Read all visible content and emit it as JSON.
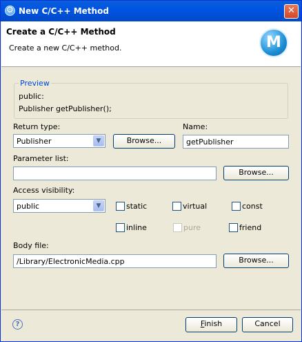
{
  "window": {
    "title": "New C/C++ Method"
  },
  "header": {
    "title": "Create a C/C++ Method",
    "description": "Create a new C/C++ method.",
    "logo_letter": "M"
  },
  "preview": {
    "legend": "Preview",
    "line1": "public:",
    "line2": "Publisher getPublisher();"
  },
  "return_type": {
    "label": "Return type:",
    "value": "Publisher",
    "browse_label": "Browse..."
  },
  "name": {
    "label": "Name:",
    "value": "getPublisher"
  },
  "parameter_list": {
    "label": "Parameter list:",
    "value": "",
    "browse_label": "Browse..."
  },
  "access": {
    "label": "Access visibility:",
    "value": "public"
  },
  "modifiers": {
    "static": "static",
    "virtual": "virtual",
    "const": "const",
    "inline": "inline",
    "pure": "pure",
    "friend": "friend"
  },
  "body_file": {
    "label": "Body file:",
    "value": "/Library/ElectronicMedia.cpp",
    "browse_label": "Browse..."
  },
  "footer": {
    "help_glyph": "?",
    "finish_first": "F",
    "finish_rest": "inish",
    "cancel_label": "Cancel"
  }
}
